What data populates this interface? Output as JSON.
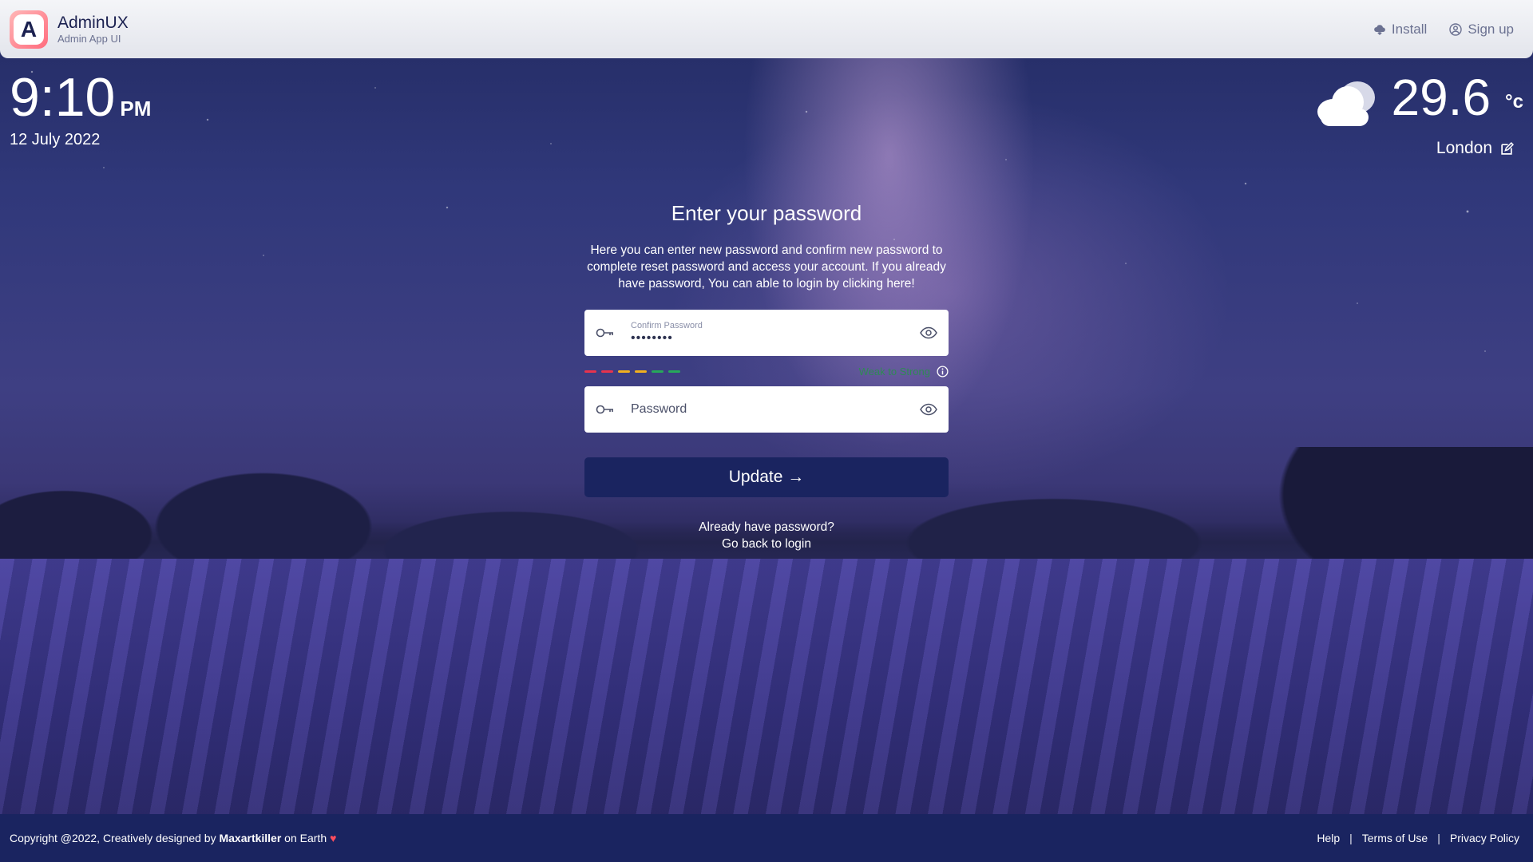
{
  "header": {
    "brand_name": "AdminUX",
    "brand_sub": "Admin App UI",
    "logo_letter": "A",
    "install_label": "Install",
    "signup_label": "Sign up"
  },
  "clock": {
    "time": "9:10",
    "ampm": "PM",
    "date": "12 July 2022"
  },
  "weather": {
    "icon": "cloud-icon",
    "temperature": "29.6",
    "unit": "°c",
    "city": "London"
  },
  "form": {
    "title": "Enter your password",
    "description": "Here you can enter new password and confirm new password to complete reset password and access your account. If you already have password, You can able to login by clicking here!",
    "confirm_label": "Confirm Password",
    "confirm_value": "••••••••",
    "strength_text": "Weak to Strong",
    "strength_colors": [
      "#e8334d",
      "#e8334d",
      "#f2b01e",
      "#f2b01e",
      "#27a85a",
      "#27a85a"
    ],
    "password_placeholder": "Password",
    "update_label": "Update →",
    "already_text": "Already have password?",
    "back_link": "Go back to login"
  },
  "footer": {
    "copyright_prefix": "Copyright @2022, Creatively designed by ",
    "author": "Maxartkiller",
    "copyright_suffix": " on Earth",
    "heart": "♥",
    "links": [
      "Help",
      "Terms of Use",
      "Privacy Policy"
    ],
    "separator": "|"
  },
  "colors": {
    "primary": "#1a2460",
    "strength_text": "#2f8a55"
  }
}
